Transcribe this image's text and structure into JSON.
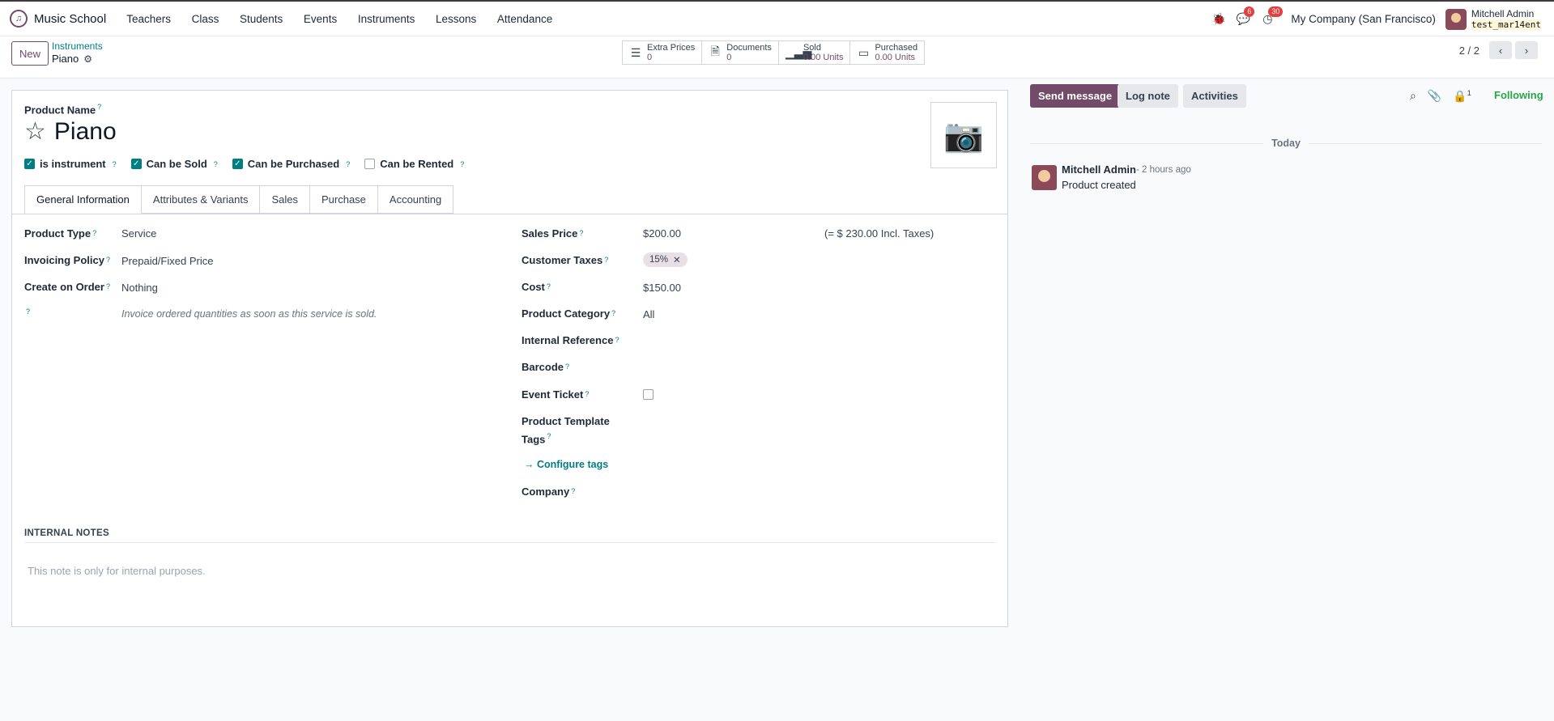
{
  "app": {
    "name": "Music School"
  },
  "menu": [
    "Teachers",
    "Class",
    "Students",
    "Events",
    "Instruments",
    "Lessons",
    "Attendance"
  ],
  "systray": {
    "messages_badge": "6",
    "activities_badge": "30",
    "company": "My Company (San Francisco)",
    "user_name": "Mitchell Admin",
    "db_name": "test_mar14ent"
  },
  "control": {
    "new_label": "New",
    "breadcrumb_parent": "Instruments",
    "breadcrumb_current": "Piano",
    "pager": "2 / 2"
  },
  "smart_buttons": [
    {
      "title": "Extra Prices",
      "value": "0",
      "icon": "list-icon"
    },
    {
      "title": "Documents",
      "value": "0",
      "icon": "document-icon"
    },
    {
      "title": "Sold",
      "value": "0.00 Units",
      "icon": "chart-bars-icon"
    },
    {
      "title": "Purchased",
      "value": "0.00 Units",
      "icon": "credit-card-icon"
    }
  ],
  "form": {
    "product_name_label": "Product Name",
    "product_name": "Piano",
    "checkboxes": [
      {
        "label": "is instrument",
        "checked": true
      },
      {
        "label": "Can be Sold",
        "checked": true
      },
      {
        "label": "Can be Purchased",
        "checked": true
      },
      {
        "label": "Can be Rented",
        "checked": false
      }
    ],
    "tabs": [
      "General Information",
      "Attributes & Variants",
      "Sales",
      "Purchase",
      "Accounting"
    ],
    "left_fields": {
      "product_type_label": "Product Type",
      "product_type": "Service",
      "invoicing_policy_label": "Invoicing Policy",
      "invoicing_policy": "Prepaid/Fixed Price",
      "create_on_order_label": "Create on Order",
      "create_on_order": "Nothing",
      "help_text": "Invoice ordered quantities as soon as this service is sold."
    },
    "right_fields": {
      "sales_price_label": "Sales Price",
      "sales_price": "$200.00",
      "incl_taxes": "(= $ 230.00 Incl. Taxes)",
      "customer_taxes_label": "Customer Taxes",
      "customer_tax_tag": "15%",
      "cost_label": "Cost",
      "cost": "$150.00",
      "product_category_label": "Product Category",
      "product_category": "All",
      "internal_reference_label": "Internal Reference",
      "barcode_label": "Barcode",
      "event_ticket_label": "Event Ticket",
      "template_tags_label_1": "Product Template",
      "template_tags_label_2": "Tags",
      "configure_tags": "Configure tags",
      "company_label": "Company"
    },
    "internal_notes_header": "INTERNAL NOTES",
    "internal_notes_placeholder": "This note is only for internal purposes."
  },
  "chatter": {
    "send_message": "Send message",
    "log_note": "Log note",
    "activities": "Activities",
    "followers_count": "1",
    "following": "Following",
    "date_separator": "Today",
    "message": {
      "author": "Mitchell Admin",
      "time": "- 2 hours ago",
      "body": "Product created"
    }
  }
}
